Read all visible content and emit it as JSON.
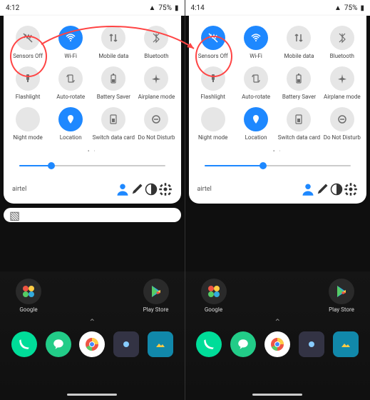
{
  "left": {
    "time": "4:12",
    "battery": "75%",
    "brightness_pct": 22,
    "carrier": "airtel",
    "tiles": [
      {
        "id": "sensors-off",
        "label": "Sensors Off",
        "on": false,
        "icon": "sensors"
      },
      {
        "id": "wifi",
        "label": "Wi-Fi",
        "on": true,
        "icon": "wifi"
      },
      {
        "id": "mobile-data",
        "label": "Mobile data",
        "on": false,
        "icon": "data"
      },
      {
        "id": "bluetooth",
        "label": "Bluetooth",
        "on": false,
        "icon": "bt"
      },
      {
        "id": "flashlight",
        "label": "Flashlight",
        "on": false,
        "icon": "flash"
      },
      {
        "id": "auto-rotate",
        "label": "Auto-rotate",
        "on": false,
        "icon": "rotate"
      },
      {
        "id": "battery-saver",
        "label": "Battery Saver",
        "on": false,
        "icon": "batt"
      },
      {
        "id": "airplane",
        "label": "Airplane mode",
        "on": false,
        "icon": "plane"
      },
      {
        "id": "night-mode",
        "label": "Night mode",
        "on": false,
        "icon": "moon"
      },
      {
        "id": "location",
        "label": "Location",
        "on": true,
        "icon": "loc"
      },
      {
        "id": "switch-data",
        "label": "Switch data card",
        "on": false,
        "icon": "sim"
      },
      {
        "id": "dnd",
        "label": "Do Not Disturb",
        "on": false,
        "icon": "dnd"
      }
    ],
    "folders": [
      {
        "label": "Google"
      },
      {
        "label": "Play Store"
      }
    ]
  },
  "right": {
    "time": "4:14",
    "battery": "75%",
    "brightness_pct": 40,
    "carrier": "airtel",
    "tiles": [
      {
        "id": "sensors-off",
        "label": "Sensors Off",
        "on": true,
        "icon": "sensors"
      },
      {
        "id": "wifi",
        "label": "Wi-Fi",
        "on": true,
        "icon": "wifi"
      },
      {
        "id": "mobile-data",
        "label": "Mobile data",
        "on": false,
        "icon": "data"
      },
      {
        "id": "bluetooth",
        "label": "Bluetooth",
        "on": false,
        "icon": "bt"
      },
      {
        "id": "flashlight",
        "label": "Flashlight",
        "on": false,
        "icon": "flash"
      },
      {
        "id": "auto-rotate",
        "label": "Auto-rotate",
        "on": false,
        "icon": "rotate"
      },
      {
        "id": "battery-saver",
        "label": "Battery Saver",
        "on": false,
        "icon": "batt"
      },
      {
        "id": "airplane",
        "label": "Airplane mode",
        "on": false,
        "icon": "plane"
      },
      {
        "id": "night-mode",
        "label": "Night mode",
        "on": false,
        "icon": "moon"
      },
      {
        "id": "location",
        "label": "Location",
        "on": true,
        "icon": "loc"
      },
      {
        "id": "switch-data",
        "label": "Switch data card",
        "on": false,
        "icon": "sim"
      },
      {
        "id": "dnd",
        "label": "Do Not Disturb",
        "on": false,
        "icon": "dnd"
      }
    ],
    "folders": [
      {
        "label": "Google"
      },
      {
        "label": "Play Store"
      }
    ]
  }
}
